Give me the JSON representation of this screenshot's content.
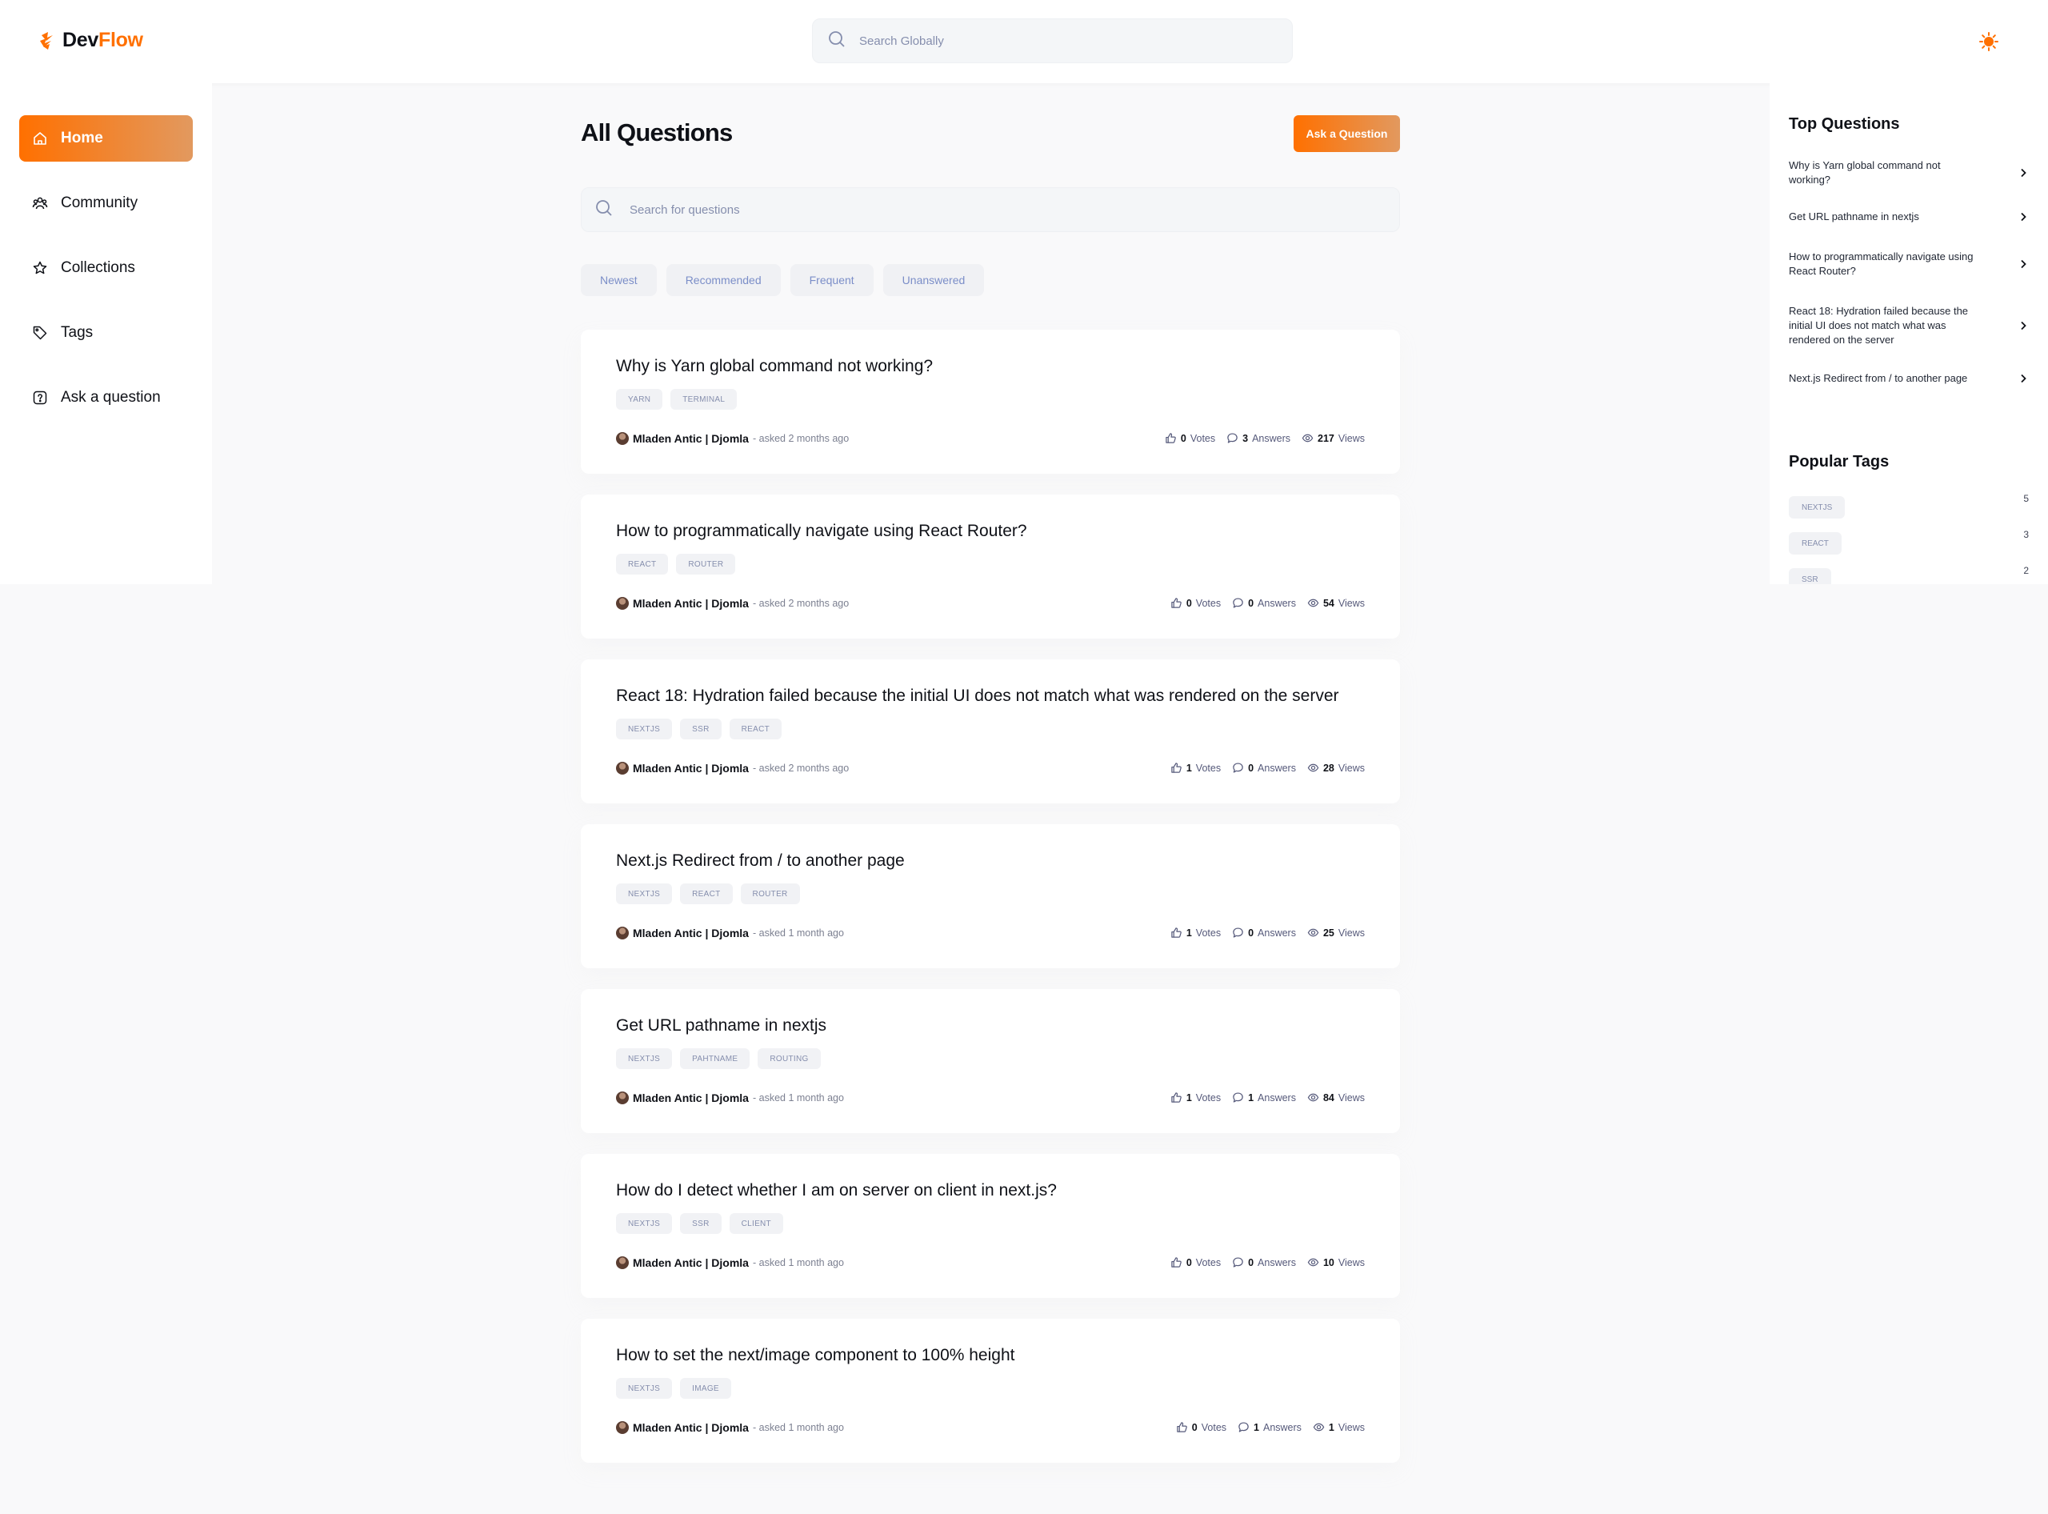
{
  "navbar": {
    "logo_dev": "Dev",
    "logo_flow": "Flow",
    "global_search_placeholder": "Search Globally"
  },
  "sidebar": {
    "items": [
      {
        "label": "Home",
        "icon": "home-icon",
        "active": true
      },
      {
        "label": "Community",
        "icon": "users-icon",
        "active": false
      },
      {
        "label": "Collections",
        "icon": "star-icon",
        "active": false
      },
      {
        "label": "Tags",
        "icon": "tag-icon",
        "active": false
      },
      {
        "label": "Ask a question",
        "icon": "question-icon",
        "active": false
      }
    ]
  },
  "main": {
    "title": "All Questions",
    "ask_button": "Ask a Question",
    "search_placeholder": "Search for questions",
    "filters": [
      "Newest",
      "Recommended",
      "Frequent",
      "Unanswered"
    ],
    "questions": [
      {
        "title": "Why is Yarn global command not working?",
        "tags": [
          "YARN",
          "TERMINAL"
        ],
        "author": "Mladen Antic | Djomla",
        "asked": "- asked 2 months ago",
        "votes": "0",
        "answers": "3",
        "views": "217"
      },
      {
        "title": "How to programmatically navigate using React Router?",
        "tags": [
          "REACT",
          "ROUTER"
        ],
        "author": "Mladen Antic | Djomla",
        "asked": "- asked 2 months ago",
        "votes": "0",
        "answers": "0",
        "views": "54"
      },
      {
        "title": "React 18: Hydration failed because the initial UI does not match what was rendered on the server",
        "tags": [
          "NEXTJS",
          "SSR",
          "REACT"
        ],
        "author": "Mladen Antic | Djomla",
        "asked": "- asked 2 months ago",
        "votes": "1",
        "answers": "0",
        "views": "28"
      },
      {
        "title": "Next.js Redirect from / to another page",
        "tags": [
          "NEXTJS",
          "REACT",
          "ROUTER"
        ],
        "author": "Mladen Antic | Djomla",
        "asked": "- asked 1 month ago",
        "votes": "1",
        "answers": "0",
        "views": "25"
      },
      {
        "title": "Get URL pathname in nextjs",
        "tags": [
          "NEXTJS",
          "PAHTNAME",
          "ROUTING"
        ],
        "author": "Mladen Antic | Djomla",
        "asked": "- asked 1 month ago",
        "votes": "1",
        "answers": "1",
        "views": "84"
      },
      {
        "title": "How do I detect whether I am on server on client in next.js?",
        "tags": [
          "NEXTJS",
          "SSR",
          "CLIENT"
        ],
        "author": "Mladen Antic | Djomla",
        "asked": "- asked 1 month ago",
        "votes": "0",
        "answers": "0",
        "views": "10"
      },
      {
        "title": "How to set the next/image component to 100% height",
        "tags": [
          "NEXTJS",
          "IMAGE"
        ],
        "author": "Mladen Antic | Djomla",
        "asked": "- asked 1 month ago",
        "votes": "0",
        "answers": "1",
        "views": "1"
      }
    ],
    "stat_labels": {
      "votes": "Votes",
      "answers": "Answers",
      "views": "Views"
    }
  },
  "right_sidebar": {
    "top_questions_heading": "Top Questions",
    "top_questions": [
      "Why is Yarn global command not working?",
      "Get URL pathname in nextjs",
      "How to programmatically navigate using React Router?",
      "React 18: Hydration failed because the initial UI does not match what was rendered on the server",
      "Next.js Redirect from / to another page"
    ],
    "popular_tags_heading": "Popular Tags",
    "popular_tags": [
      {
        "name": "NEXTJS",
        "count": "5"
      },
      {
        "name": "REACT",
        "count": "3"
      },
      {
        "name": "SSR",
        "count": "2"
      }
    ]
  },
  "colors": {
    "accent": "#ff7000",
    "accent_gradient_end": "#e2995f"
  }
}
